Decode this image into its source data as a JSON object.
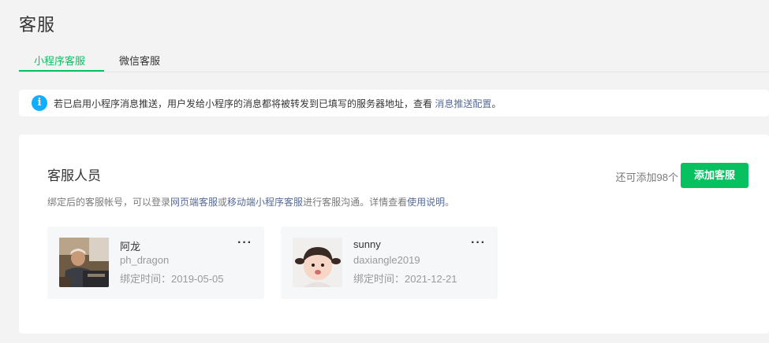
{
  "page": {
    "title": "客服"
  },
  "tabs": [
    {
      "label": "小程序客服",
      "active": true
    },
    {
      "label": "微信客服",
      "active": false
    }
  ],
  "notice": {
    "icon": "info-icon",
    "text": "若已启用小程序消息推送，用户发给小程序的消息都将被转发到已填写的服务器地址，查看 ",
    "link": "消息推送配置",
    "suffix": "。"
  },
  "section": {
    "title": "客服人员",
    "remaining": "还可添加98个",
    "add_button": "添加客服",
    "desc": {
      "part1": "绑定后的客服帐号，可以登录",
      "link1": "网页端客服",
      "part2": "或",
      "link2": "移动端小程序客服",
      "part3": "进行客服沟通。详情查看",
      "link3": "使用说明",
      "part4": "。"
    }
  },
  "agents": [
    {
      "name": "阿龙",
      "account": "ph_dragon",
      "bind_label": "绑定时间：",
      "bind_date": "2019-05-05",
      "more": "···"
    },
    {
      "name": "sunny",
      "account": "daxiangle2019",
      "bind_label": "绑定时间：",
      "bind_date": "2021-12-21",
      "more": "···"
    }
  ],
  "colors": {
    "accent": "#07c160",
    "link": "#576b95",
    "info": "#10aeff"
  }
}
